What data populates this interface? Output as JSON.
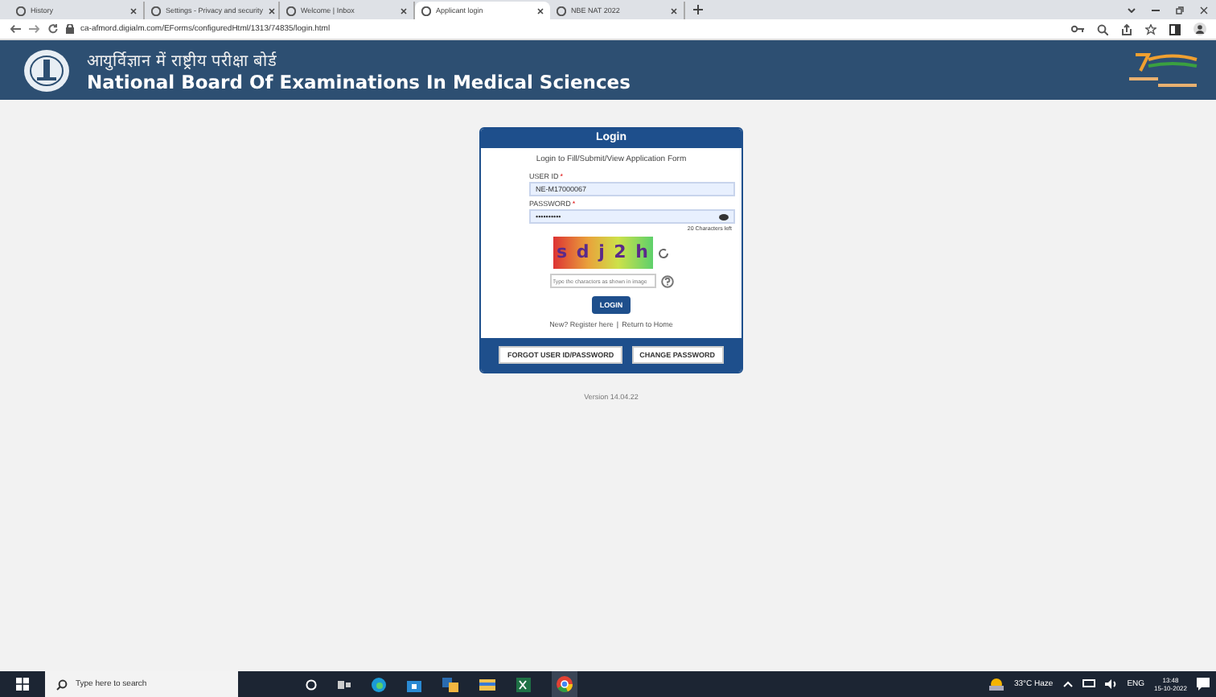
{
  "browser": {
    "tabs": [
      {
        "title": "History",
        "selected": false
      },
      {
        "title": "Settings - Privacy and security",
        "selected": false
      },
      {
        "title": "Welcome | Inbox",
        "selected": false
      },
      {
        "title": "Applicant login",
        "selected": true
      },
      {
        "title": "NBE NAT 2022",
        "selected": false
      }
    ],
    "url": "ca-afmord.digialm.com/EForms/configuredHtml/1313/74835/login.html"
  },
  "header": {
    "title_hindi": "आयुर्विज्ञान में राष्ट्रीय परीक्षा बोर्ड",
    "title": "National Board Of Examinations In Medical Sciences"
  },
  "login": {
    "heading": "Login",
    "subtitle": "Login to Fill/Submit/View Application Form",
    "required_mark": "*",
    "link_separator": "|",
    "user_id_label": "USER ID",
    "user_id_value": "NE-M17000067",
    "password_label": "PASSWORD",
    "password_value": "••••••••••",
    "chars_left": "20 Characters left",
    "captcha_text": "s d j 2 h",
    "captcha_placeholder": "Type the characters as shown in image",
    "login_button": "LOGIN",
    "register_link": "New? Register here",
    "home_link": "Return to Home",
    "footer_buttons": [
      "FORGOT USER ID/PASSWORD",
      "CHANGE PASSWORD"
    ]
  },
  "version": "Version 14.04.22",
  "taskbar": {
    "search_placeholder": "Type here to search",
    "weather": "33°C Haze",
    "language": "ENG",
    "time": "13:48",
    "date": "15-10-2022"
  }
}
